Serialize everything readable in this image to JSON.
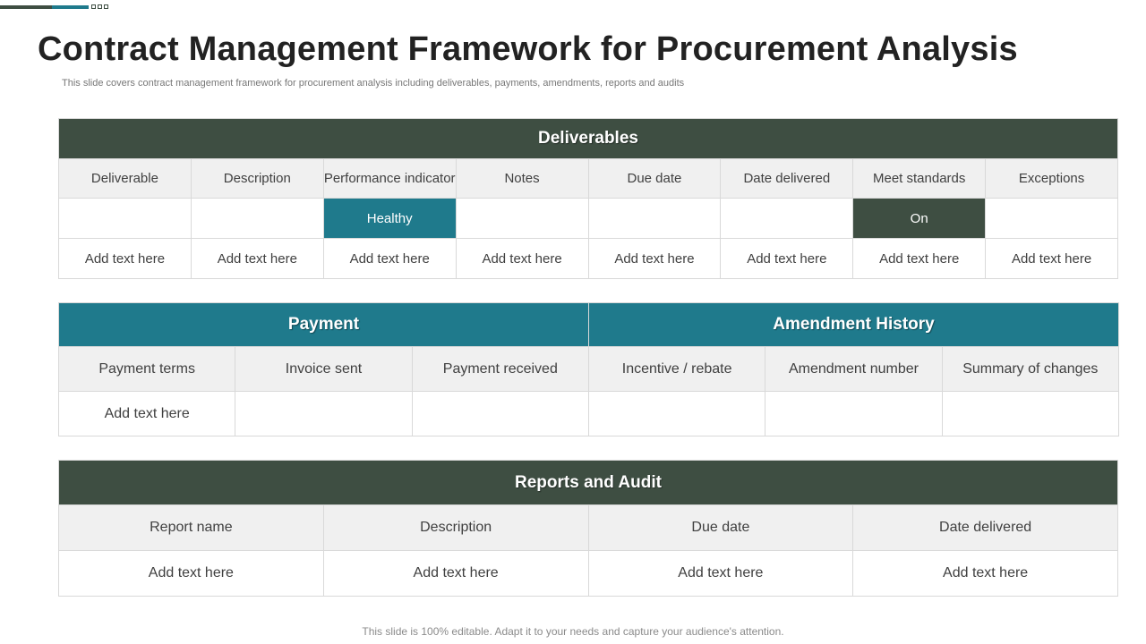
{
  "colors": {
    "dark_green": "#3e4e42",
    "teal": "#1f7a8c"
  },
  "title": "Contract Management Framework for Procurement Analysis",
  "subtitle": "This slide covers contract management framework for procurement analysis including deliverables, payments, amendments, reports and audits",
  "deliverables": {
    "heading": "Deliverables",
    "columns": [
      "Deliverable",
      "Description",
      "Performance indicator",
      "Notes",
      "Due date",
      "Date delivered",
      "Meet standards",
      "Exceptions"
    ],
    "row1": [
      "",
      "",
      "Healthy",
      "",
      "",
      "",
      "On",
      ""
    ],
    "row2": [
      "Add text here",
      "Add text here",
      "Add text here",
      "Add text here",
      "Add text here",
      "Add text here",
      "Add text here",
      "Add text here"
    ]
  },
  "payment": {
    "heading": "Payment",
    "columns": [
      "Payment terms",
      "Invoice sent",
      "Payment received"
    ],
    "row1": [
      "Add text here",
      "",
      ""
    ]
  },
  "amendment": {
    "heading": "Amendment History",
    "columns": [
      "Incentive  / rebate",
      "Amendment number",
      "Summary  of changes"
    ],
    "row1": [
      "",
      "",
      ""
    ]
  },
  "reports": {
    "heading": "Reports and Audit",
    "columns": [
      "Report name",
      "Description",
      "Due date",
      "Date delivered"
    ],
    "row1": [
      "Add text here",
      "Add text here",
      "Add text here",
      "Add text here"
    ]
  },
  "footer": "This slide is 100% editable. Adapt it to your needs and capture your audience's attention."
}
